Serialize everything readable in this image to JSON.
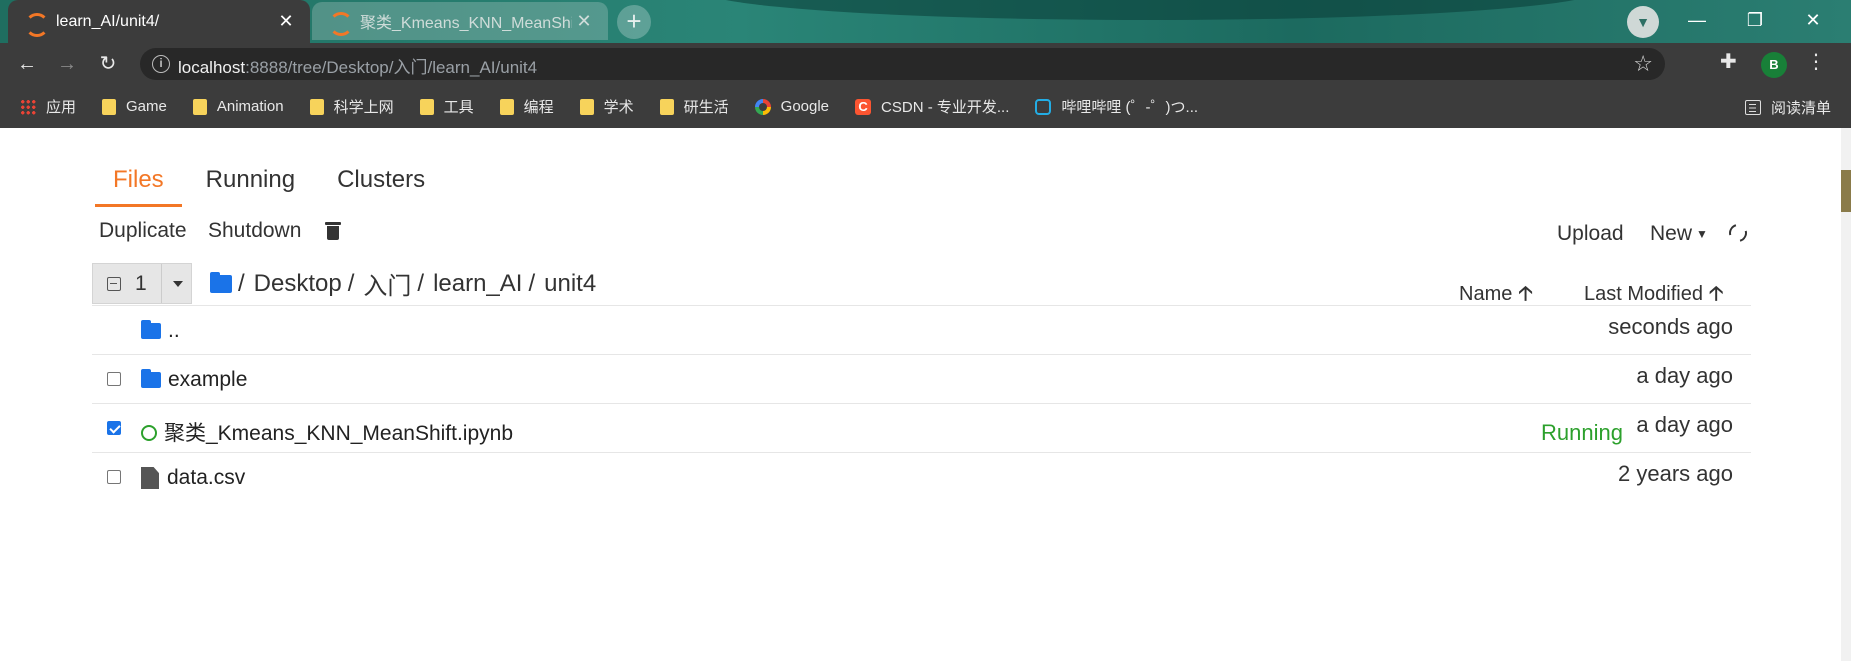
{
  "browser": {
    "tabs": [
      {
        "title": "learn_AI/unit4/",
        "close": "✕",
        "active": true
      },
      {
        "title": "聚类_Kmeans_KNN_MeanShift",
        "close": "✕",
        "active": false
      }
    ],
    "new_tab": "+",
    "window_controls": {
      "minimize": "—",
      "restore": "❐",
      "close": "✕"
    },
    "nav": {
      "back": "←",
      "forward": "→",
      "reload": "↻"
    },
    "address": {
      "host": "localhost",
      "path": ":8888/tree/Desktop/入门/learn_AI/unit4"
    },
    "profile_initial": "B",
    "bookmarks": [
      {
        "label": "应用",
        "icon": "apps-grid-icon"
      },
      {
        "label": "Game",
        "icon": "folder-icon"
      },
      {
        "label": "Animation",
        "icon": "folder-icon"
      },
      {
        "label": "科学上网",
        "icon": "folder-icon"
      },
      {
        "label": "工具",
        "icon": "folder-icon"
      },
      {
        "label": "编程",
        "icon": "folder-icon"
      },
      {
        "label": "学术",
        "icon": "folder-icon"
      },
      {
        "label": "研生活",
        "icon": "folder-icon"
      },
      {
        "label": "Google",
        "icon": "google-icon"
      },
      {
        "label": "CSDN - 专业开发...",
        "icon": "csdn-icon"
      },
      {
        "label": "哔哩哔哩 (゜-゜)つ...",
        "icon": "bilibili-icon"
      }
    ],
    "reading_list": "阅读清单"
  },
  "jupyter": {
    "nav_tabs": [
      {
        "label": "Files",
        "active": true
      },
      {
        "label": "Running",
        "active": false
      },
      {
        "label": "Clusters",
        "active": false
      }
    ],
    "actions": {
      "duplicate": "Duplicate",
      "shutdown": "Shutdown",
      "upload": "Upload",
      "new": "New"
    },
    "selected_count": "1",
    "breadcrumb": [
      "Desktop",
      "入门",
      "learn_AI",
      "unit4"
    ],
    "breadcrumb_sep": "/",
    "columns": {
      "name": "Name",
      "last_modified": "Last Modified",
      "sort_arrow": "🡡"
    },
    "files": [
      {
        "name": "..",
        "type": "folder",
        "checked": false,
        "checkbox": false,
        "modified": "seconds ago",
        "status": ""
      },
      {
        "name": "example",
        "type": "folder",
        "checked": false,
        "checkbox": true,
        "modified": "a day ago",
        "status": ""
      },
      {
        "name": "聚类_Kmeans_KNN_MeanShift.ipynb",
        "type": "notebook",
        "checked": true,
        "checkbox": true,
        "modified": "a day ago",
        "status": "Running"
      },
      {
        "name": "data.csv",
        "type": "file",
        "checked": false,
        "checkbox": true,
        "modified": "2 years ago",
        "status": ""
      }
    ]
  }
}
